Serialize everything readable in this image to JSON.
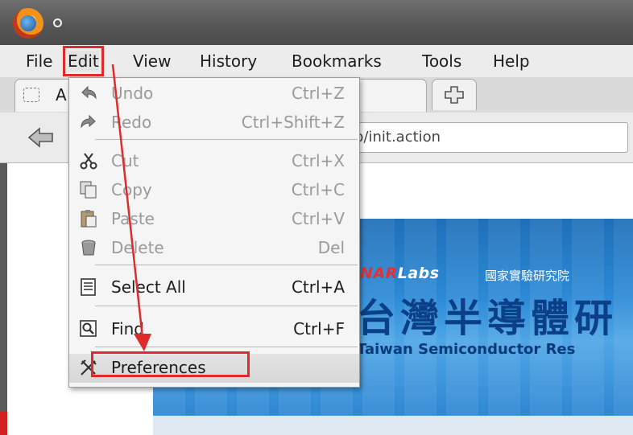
{
  "window": {
    "title_indicator": "○"
  },
  "menubar": [
    {
      "label": "File"
    },
    {
      "label": "Edit"
    },
    {
      "label": "View"
    },
    {
      "label": "History"
    },
    {
      "label": "Bookmarks"
    },
    {
      "label": "Tools"
    },
    {
      "label": "Help"
    }
  ],
  "tab": {
    "label": "A"
  },
  "navbar": {
    "url_visible": "p/init.action"
  },
  "edit_menu": [
    {
      "label": "Undo",
      "shortcut": "Ctrl+Z",
      "icon": "undo-icon",
      "enabled": false
    },
    {
      "label": "Redo",
      "shortcut": "Ctrl+Shift+Z",
      "icon": "redo-icon",
      "enabled": false
    },
    {
      "label": "Cut",
      "shortcut": "Ctrl+X",
      "icon": "scissors-icon",
      "enabled": false
    },
    {
      "label": "Copy",
      "shortcut": "Ctrl+C",
      "icon": "copy-icon",
      "enabled": false
    },
    {
      "label": "Paste",
      "shortcut": "Ctrl+V",
      "icon": "paste-icon",
      "enabled": false
    },
    {
      "label": "Delete",
      "shortcut": "Del",
      "icon": "trash-icon",
      "enabled": false
    },
    {
      "label": "Select All",
      "shortcut": "Ctrl+A",
      "icon": "select-all-icon",
      "enabled": true
    },
    {
      "label": "Find",
      "shortcut": "Ctrl+F",
      "icon": "find-icon",
      "enabled": true
    },
    {
      "label": "Preferences",
      "shortcut": "",
      "icon": "preferences-icon",
      "enabled": true,
      "highlighted": true
    }
  ],
  "banner": {
    "org_nar": "NAR",
    "org_labs": "Labs",
    "org_cn": "國家實驗研究院",
    "title_cn": "台灣半導體研",
    "title_en": "Taiwan Semiconductor Res"
  },
  "annotation": {
    "highlight_color": "#e02b2b"
  }
}
